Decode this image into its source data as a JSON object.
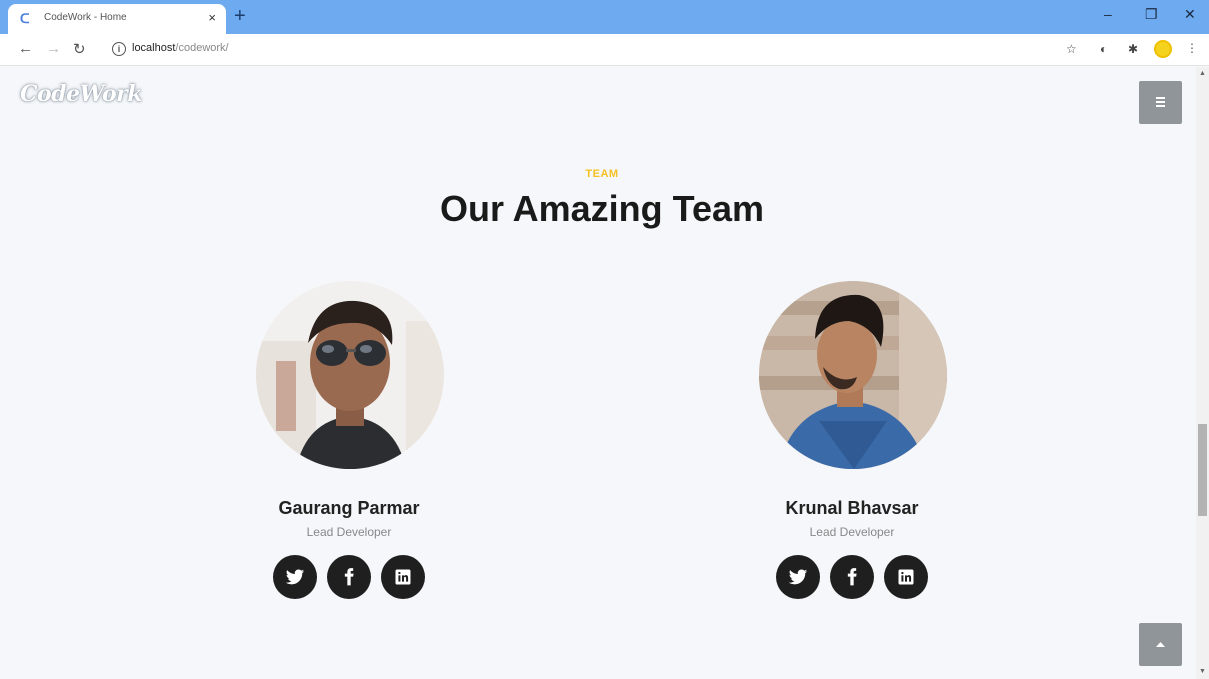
{
  "browser": {
    "tab_title": "CodeWork - Home",
    "tab_close": "×",
    "new_tab": "+",
    "url_host": "localhost",
    "url_path": "/codework/",
    "win_minimize": "–",
    "win_restore": "❐",
    "win_close": "✕"
  },
  "page": {
    "logo": "CodeWork",
    "kicker": "TEAM",
    "heading": "Our Amazing Team"
  },
  "team": [
    {
      "name": "Gaurang Parmar",
      "role": "Lead Developer",
      "socials": [
        "twitter",
        "facebook",
        "linkedin"
      ]
    },
    {
      "name": "Krunal Bhavsar",
      "role": "Lead Developer",
      "socials": [
        "twitter",
        "facebook",
        "linkedin"
      ]
    }
  ],
  "colors": {
    "accent": "#f5c022",
    "heading": "#1a1a1a",
    "social_bg": "#1f1f1f",
    "button_bg": "#8f9599",
    "tabbar": "#6eaaf0"
  }
}
